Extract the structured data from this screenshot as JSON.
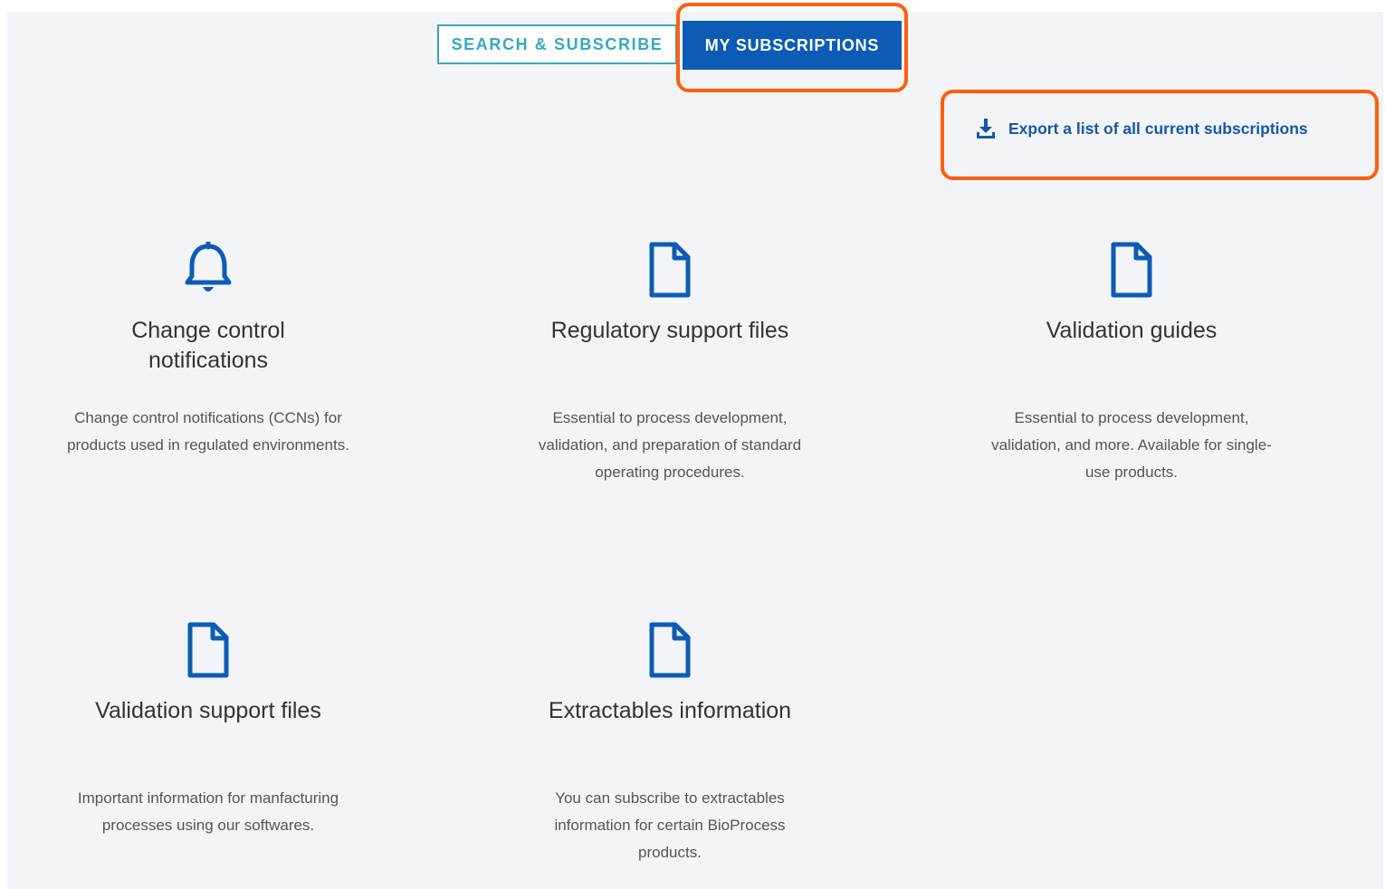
{
  "tabs": {
    "search_label": "SEARCH & SUBSCRIBE",
    "my_subscriptions_label": "MY SUBSCRIPTIONS"
  },
  "export": {
    "label": "Export a list of all current subscriptions",
    "icon": "download-icon"
  },
  "colors": {
    "accent_blue": "#0d5bb5",
    "tab_teal": "#3aa6c0",
    "highlight_orange": "#ff5e0e",
    "background": "#f2f4f7"
  },
  "cards": [
    {
      "icon": "bell-icon",
      "title_line1": "Change control",
      "title_line2": "notifications",
      "desc": "Change control notifications (CCNs) for products used in regulated environments."
    },
    {
      "icon": "document-icon",
      "title_line1": "Regulatory support files",
      "title_line2": "",
      "desc": "Essential to process development, validation, and preparation of standard operating procedures."
    },
    {
      "icon": "document-icon",
      "title_line1": "Validation guides",
      "title_line2": "",
      "desc": "Essential to process development, validation, and more. Available for single-use products."
    },
    {
      "icon": "document-icon",
      "title_line1": "Validation support files",
      "title_line2": "",
      "desc": "Important information for manfacturing processes using our softwares."
    },
    {
      "icon": "document-icon",
      "title_line1": "Extractables information",
      "title_line2": "",
      "desc": "You can subscribe to extractables information for certain BioProcess products."
    }
  ]
}
